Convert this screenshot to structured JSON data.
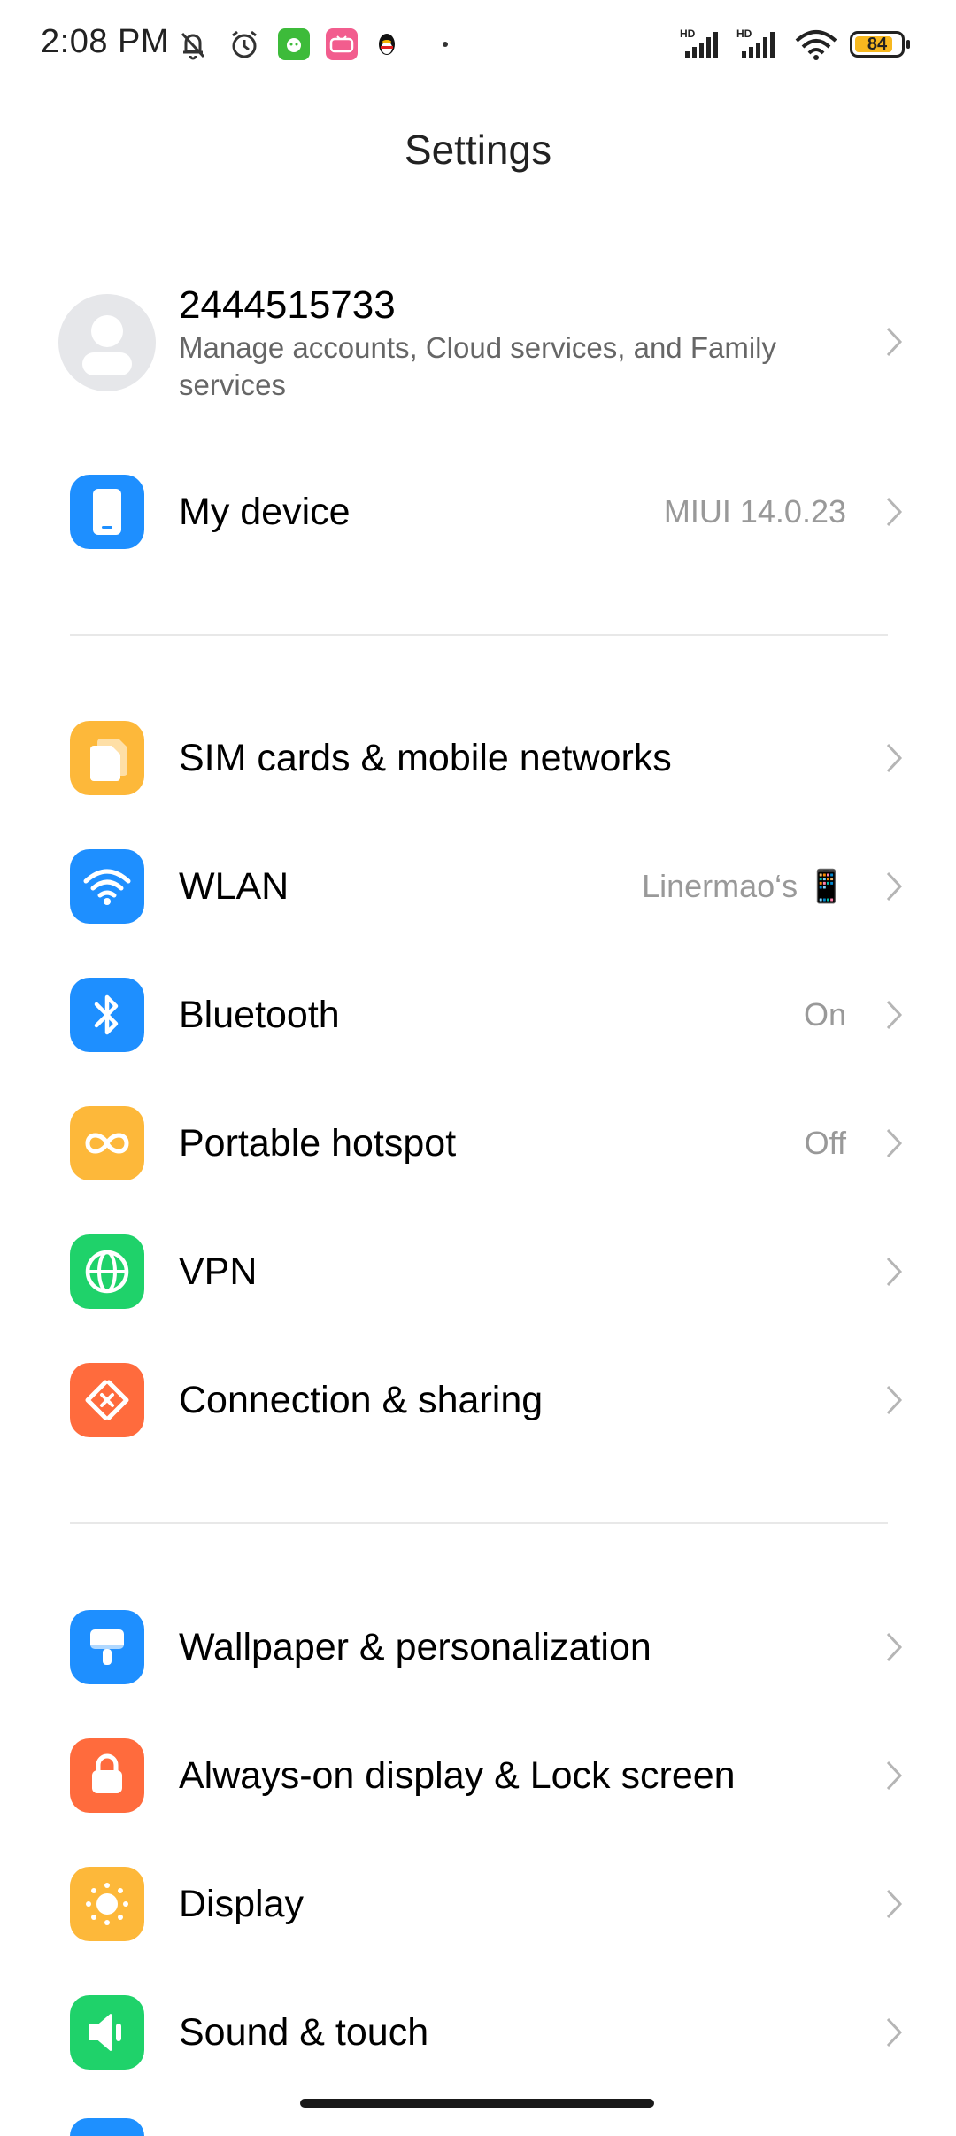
{
  "status_bar": {
    "time": "2:08 PM",
    "battery": "84",
    "signal_1_label": "HD",
    "signal_2_label": "HD"
  },
  "header": {
    "title": "Settings"
  },
  "account": {
    "id": "2444515733",
    "subtitle": "Manage accounts, Cloud services, and Family services"
  },
  "my_device": {
    "label": "My device",
    "value": "MIUI 14.0.23"
  },
  "network_section": [
    {
      "label": "SIM cards & mobile networks",
      "value": "",
      "icon": "sim-card-icon",
      "color": "#FDB83A"
    },
    {
      "label": "WLAN",
      "value": "Linermao‘s 📱",
      "icon": "wifi-icon",
      "color": "#1E8FFF"
    },
    {
      "label": "Bluetooth",
      "value": "On",
      "icon": "bluetooth-icon",
      "color": "#1E8FFF"
    },
    {
      "label": "Portable hotspot",
      "value": "Off",
      "icon": "hotspot-icon",
      "color": "#FDB83A"
    },
    {
      "label": "VPN",
      "value": "",
      "icon": "globe-icon",
      "color": "#1FD26A"
    },
    {
      "label": "Connection & sharing",
      "value": "",
      "icon": "connection-sharing-icon",
      "color": "#FF6B3D"
    }
  ],
  "personal_section": [
    {
      "label": "Wallpaper & personalization",
      "icon": "wallpaper-icon",
      "color": "#1E8FFF"
    },
    {
      "label": "Always-on display & Lock screen",
      "icon": "lock-icon",
      "color": "#FF6B3D"
    },
    {
      "label": "Display",
      "icon": "sun-icon",
      "color": "#FDB83A"
    },
    {
      "label": "Sound & touch",
      "icon": "speaker-icon",
      "color": "#1FD26A"
    }
  ]
}
